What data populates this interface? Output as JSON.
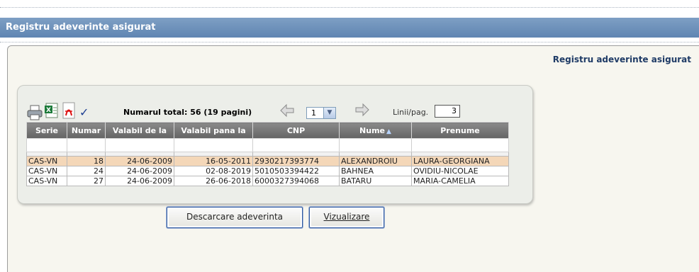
{
  "window": {
    "title": "Registru adeverinte asigurat"
  },
  "page": {
    "heading": "Registru adeverinte asigurat"
  },
  "toolbar": {
    "total_label": "Numarul total: 56 (19 pagini)",
    "page_selected": "1",
    "rows_label": "Linii/pag.",
    "rows_value": "3",
    "icons": [
      "printer-icon",
      "excel-export-icon",
      "pdf-export-icon",
      "check-icon",
      "previous-page-icon",
      "next-page-icon"
    ]
  },
  "table": {
    "columns": [
      "Serie",
      "Numar",
      "Valabil de la",
      "Valabil pana la",
      "CNP",
      "Nume",
      "Prenume"
    ],
    "sort": {
      "column": "Nume",
      "direction": "asc"
    },
    "rows": [
      [
        "CAS-VN",
        "18",
        "24-06-2009",
        "16-05-2011",
        "2930217393774",
        "ALEXANDROIU",
        "LAURA-GEORGIANA"
      ],
      [
        "CAS-VN",
        "24",
        "24-06-2009",
        "02-08-2019",
        "5010503394422",
        "BAHNEA",
        "OVIDIU-NICOLAE"
      ],
      [
        "CAS-VN",
        "27",
        "24-06-2009",
        "26-06-2018",
        "6000327394068",
        "BATARU",
        "MARIA-CAMELIA"
      ]
    ]
  },
  "buttons": {
    "download": "Descarcare adeverinta",
    "view": "Vizualizare"
  },
  "colors": {
    "title_bar": "#6a8fbb",
    "header": "#737373",
    "selected_row": "#f4d7b8",
    "heading_text": "#1f3b66"
  }
}
